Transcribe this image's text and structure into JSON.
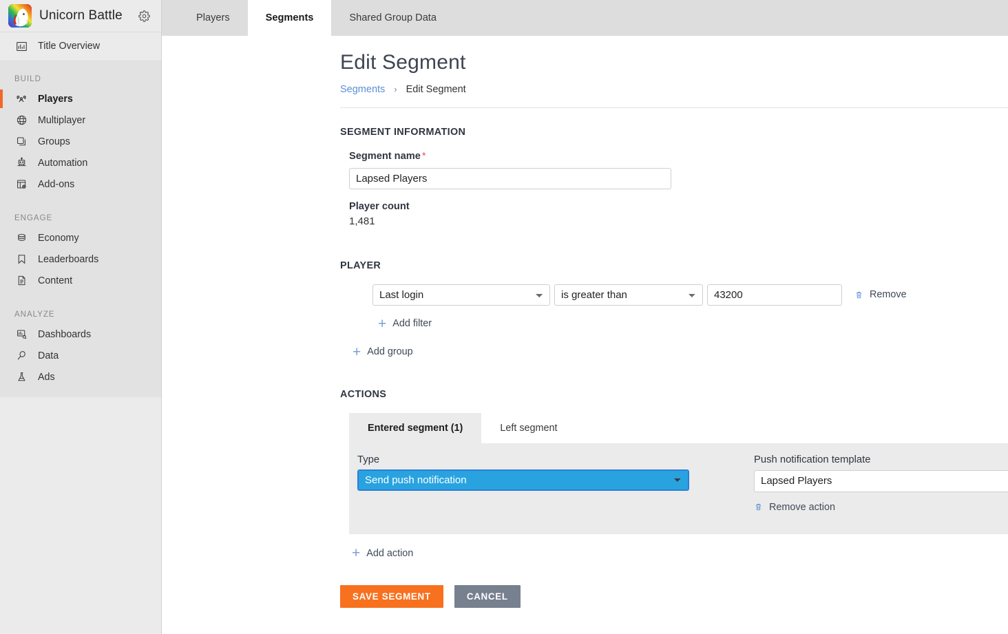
{
  "brand": {
    "title": "Unicorn Battle",
    "logo_icon": "unicorn-avatar",
    "settings_icon": "gear-icon"
  },
  "sidebar": {
    "top_items": [
      {
        "label": "Title Overview",
        "icon": "bar-chart-icon"
      }
    ],
    "groups": [
      {
        "label": "BUILD",
        "items": [
          {
            "label": "Players",
            "icon": "players-icon",
            "active": true
          },
          {
            "label": "Multiplayer",
            "icon": "globe-icon",
            "active": false
          },
          {
            "label": "Groups",
            "icon": "layers-icon",
            "active": false
          },
          {
            "label": "Automation",
            "icon": "robot-icon",
            "active": false
          },
          {
            "label": "Add-ons",
            "icon": "addons-icon",
            "active": false
          }
        ]
      },
      {
        "label": "ENGAGE",
        "items": [
          {
            "label": "Economy",
            "icon": "coins-icon",
            "active": false
          },
          {
            "label": "Leaderboards",
            "icon": "bookmark-icon",
            "active": false
          },
          {
            "label": "Content",
            "icon": "document-icon",
            "active": false
          }
        ]
      },
      {
        "label": "ANALYZE",
        "items": [
          {
            "label": "Dashboards",
            "icon": "dashboard-icon",
            "active": false
          },
          {
            "label": "Data",
            "icon": "data-plug-icon",
            "active": false
          },
          {
            "label": "Ads",
            "icon": "flask-icon",
            "active": false
          }
        ]
      }
    ]
  },
  "tabs": [
    {
      "label": "Players",
      "active": false
    },
    {
      "label": "Segments",
      "active": true
    },
    {
      "label": "Shared Group Data",
      "active": false
    }
  ],
  "page": {
    "title": "Edit Segment",
    "breadcrumb": {
      "root": "Segments",
      "separator": "›",
      "current": "Edit Segment"
    }
  },
  "segment_information": {
    "section_title": "SEGMENT INFORMATION",
    "name_label": "Segment name",
    "required_marker": "*",
    "name_value": "Lapsed Players",
    "player_count_label": "Player count",
    "player_count_value": "1,481"
  },
  "player_section": {
    "section_title": "PLAYER",
    "filter": {
      "field_value": "Last login",
      "operator_value": "is greater than",
      "value": "43200",
      "remove_label": "Remove",
      "remove_icon": "trash-icon"
    },
    "add_filter_label": "Add filter",
    "add_group_label": "Add group",
    "plus_icon": "plus-icon"
  },
  "actions_section": {
    "section_title": "ACTIONS",
    "tabs": [
      {
        "label": "Entered segment (1)",
        "active": true
      },
      {
        "label": "Left segment",
        "active": false
      }
    ],
    "type_label": "Type",
    "type_value": "Send push notification",
    "template_label": "Push notification template",
    "template_value": "Lapsed Players",
    "remove_action_label": "Remove action",
    "remove_action_icon": "trash-icon",
    "add_action_label": "Add action"
  },
  "footer": {
    "save_label": "SAVE SEGMENT",
    "cancel_label": "CANCEL"
  },
  "colors": {
    "accent_orange": "#f2682a",
    "save_button": "#f7711f",
    "cancel_button": "#76808f",
    "link_blue": "#5b8fd6",
    "select_highlight": "#29a3e0",
    "required_red": "#e8556d",
    "panel_gray": "#ebebeb"
  }
}
